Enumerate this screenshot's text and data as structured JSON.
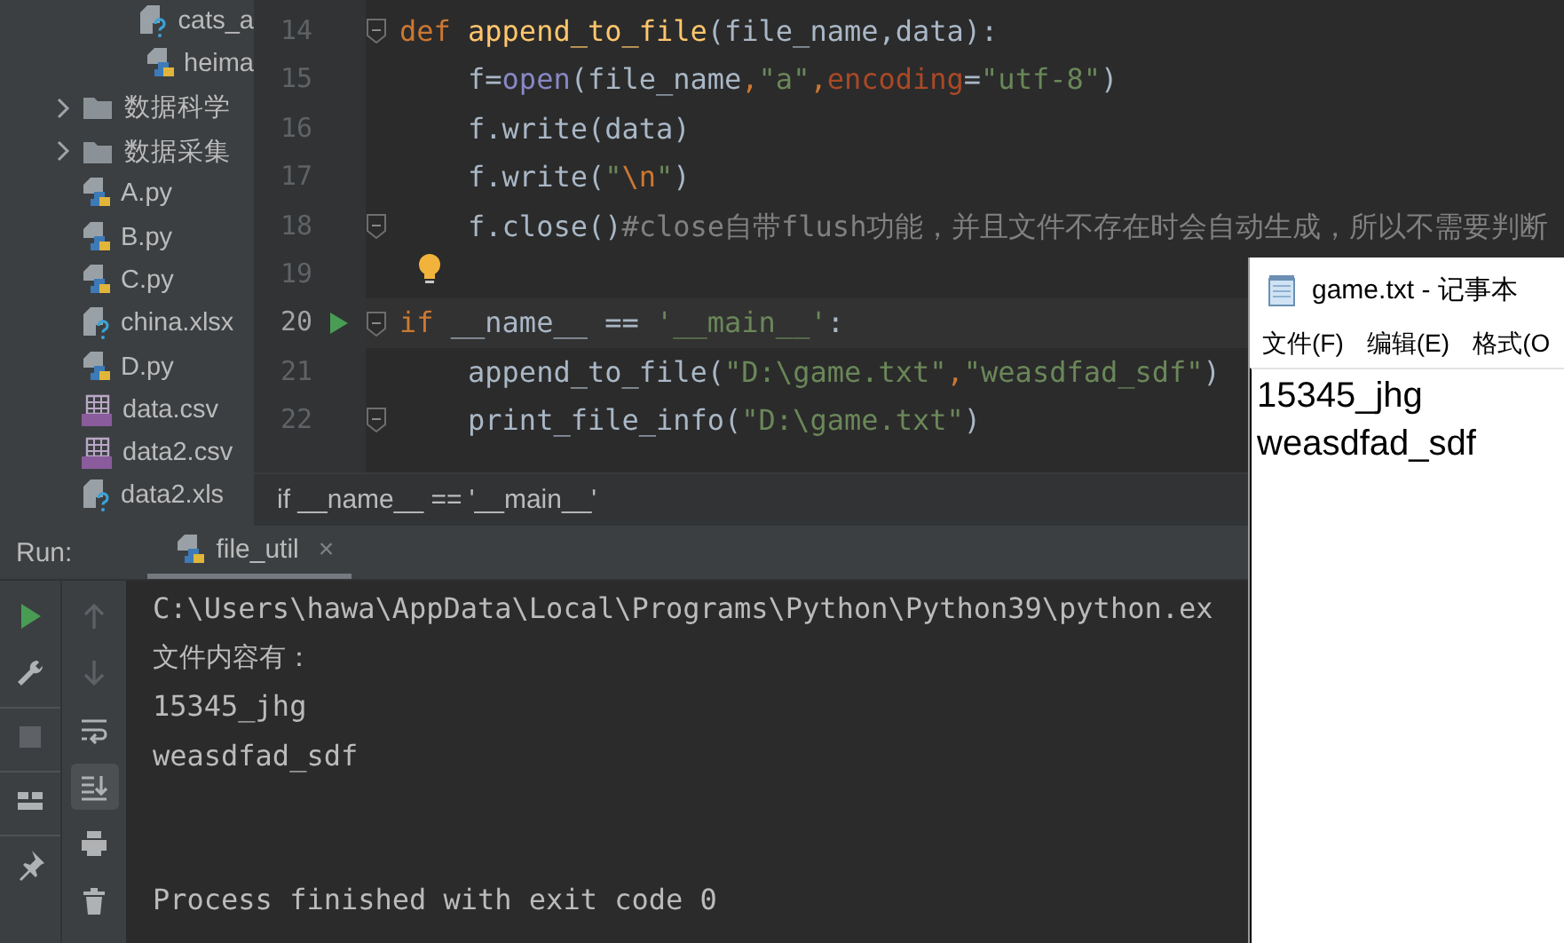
{
  "project_tree": {
    "open_folder_children": [
      {
        "label": "cats_a",
        "kind": "unknown"
      },
      {
        "label": "heima",
        "kind": "python"
      }
    ],
    "items": [
      {
        "label": "数据科学",
        "kind": "folder",
        "expanded": false
      },
      {
        "label": "数据采集",
        "kind": "folder",
        "expanded": false
      },
      {
        "label": "A.py",
        "kind": "python"
      },
      {
        "label": "B.py",
        "kind": "python"
      },
      {
        "label": "C.py",
        "kind": "python"
      },
      {
        "label": "china.xlsx",
        "kind": "unknown"
      },
      {
        "label": "D.py",
        "kind": "python"
      },
      {
        "label": "data.csv",
        "kind": "csv"
      },
      {
        "label": "data2.csv",
        "kind": "csv"
      },
      {
        "label": "data2.xls",
        "kind": "unknown"
      }
    ]
  },
  "editor": {
    "lines": [
      {
        "number": "14",
        "current": false,
        "run_marker": false,
        "fold_marker": true,
        "bulb": false,
        "tokens": [
          {
            "kind": "keyword",
            "text": "def "
          },
          {
            "kind": "function",
            "text": "append_to_file"
          },
          {
            "kind": "plain",
            "text": "(file_name,data):"
          }
        ]
      },
      {
        "number": "15",
        "current": false,
        "run_marker": false,
        "fold_marker": false,
        "bulb": false,
        "tokens": [
          {
            "kind": "plain",
            "text": "    f="
          },
          {
            "kind": "builtin",
            "text": "open"
          },
          {
            "kind": "plain",
            "text": "(file_name"
          },
          {
            "kind": "punct",
            "text": ","
          },
          {
            "kind": "string",
            "text": "\"a\""
          },
          {
            "kind": "punct",
            "text": ","
          },
          {
            "kind": "param",
            "text": "encoding"
          },
          {
            "kind": "plain",
            "text": "="
          },
          {
            "kind": "string",
            "text": "\"utf-8\""
          },
          {
            "kind": "plain",
            "text": ")"
          }
        ]
      },
      {
        "number": "16",
        "current": false,
        "run_marker": false,
        "fold_marker": false,
        "bulb": false,
        "tokens": [
          {
            "kind": "plain",
            "text": "    f.write(data)"
          }
        ]
      },
      {
        "number": "17",
        "current": false,
        "run_marker": false,
        "fold_marker": false,
        "bulb": false,
        "tokens": [
          {
            "kind": "plain",
            "text": "    f.write("
          },
          {
            "kind": "string",
            "text": "\""
          },
          {
            "kind": "punct",
            "text": "\\n"
          },
          {
            "kind": "string",
            "text": "\""
          },
          {
            "kind": "plain",
            "text": ")"
          }
        ]
      },
      {
        "number": "18",
        "current": false,
        "run_marker": false,
        "fold_marker": true,
        "bulb": false,
        "tokens": [
          {
            "kind": "plain",
            "text": "    f.close()"
          },
          {
            "kind": "comment",
            "text": "#close自带flush功能，并且文件不存在时会自动生成，所以不需要判断"
          }
        ]
      },
      {
        "number": "19",
        "current": false,
        "run_marker": false,
        "fold_marker": false,
        "bulb": true
      },
      {
        "number": "20",
        "current": true,
        "run_marker": true,
        "fold_marker": true,
        "bulb": false,
        "tokens": [
          {
            "kind": "keyword",
            "text": "if"
          },
          {
            "kind": "plain",
            "text": " __name__ == "
          },
          {
            "kind": "string",
            "text": "'__main__'"
          },
          {
            "kind": "plain",
            "text": ":"
          }
        ]
      },
      {
        "number": "21",
        "current": false,
        "run_marker": false,
        "fold_marker": false,
        "bulb": false,
        "tokens": [
          {
            "kind": "plain",
            "text": "    append_to_file("
          },
          {
            "kind": "string",
            "text": "\"D:\\game.txt\""
          },
          {
            "kind": "punct",
            "text": ","
          },
          {
            "kind": "string",
            "text": "\"weasdfad_sdf\""
          },
          {
            "kind": "plain",
            "text": ")"
          }
        ]
      },
      {
        "number": "22",
        "current": false,
        "run_marker": false,
        "fold_marker": true,
        "bulb": false,
        "tokens": [
          {
            "kind": "plain",
            "text": "    print_file_info("
          },
          {
            "kind": "string",
            "text": "\"D:\\game.txt\""
          },
          {
            "kind": "plain",
            "text": ")"
          }
        ]
      }
    ],
    "breadcrumb": "if __name__ == '__main__'"
  },
  "run_panel": {
    "label": "Run:",
    "tabs": [
      {
        "label": "file_util",
        "close": "×",
        "selected": true
      }
    ],
    "left_tools": [
      {
        "kind": "play",
        "disabled": false,
        "selected": false
      },
      {
        "kind": "wrench",
        "disabled": false,
        "selected": false
      },
      {
        "kind": "stop",
        "disabled": true,
        "selected": false
      },
      {
        "kind": "layout",
        "disabled": false,
        "selected": false
      },
      {
        "kind": "pin",
        "disabled": false,
        "selected": false
      }
    ],
    "right_tools": [
      {
        "kind": "up",
        "disabled": true,
        "selected": false
      },
      {
        "kind": "down",
        "disabled": true,
        "selected": false
      },
      {
        "kind": "wrap",
        "disabled": false,
        "selected": false
      },
      {
        "kind": "scroll_end",
        "disabled": false,
        "selected": true
      },
      {
        "kind": "print",
        "disabled": false,
        "selected": false
      },
      {
        "kind": "trash",
        "disabled": false,
        "selected": false
      }
    ],
    "output": [
      "C:\\Users\\hawa\\AppData\\Local\\Programs\\Python\\Python39\\python.ex",
      "文件内容有：",
      "15345_jhg",
      "weasdfad_sdf"
    ],
    "exit_message": "Process finished with exit code 0"
  },
  "notepad": {
    "title": "game.txt - 记事本",
    "menu": [
      "文件(F)",
      "编辑(E)",
      "格式(O"
    ],
    "lines": [
      "15345_jhg",
      "weasdfad_sdf"
    ]
  }
}
